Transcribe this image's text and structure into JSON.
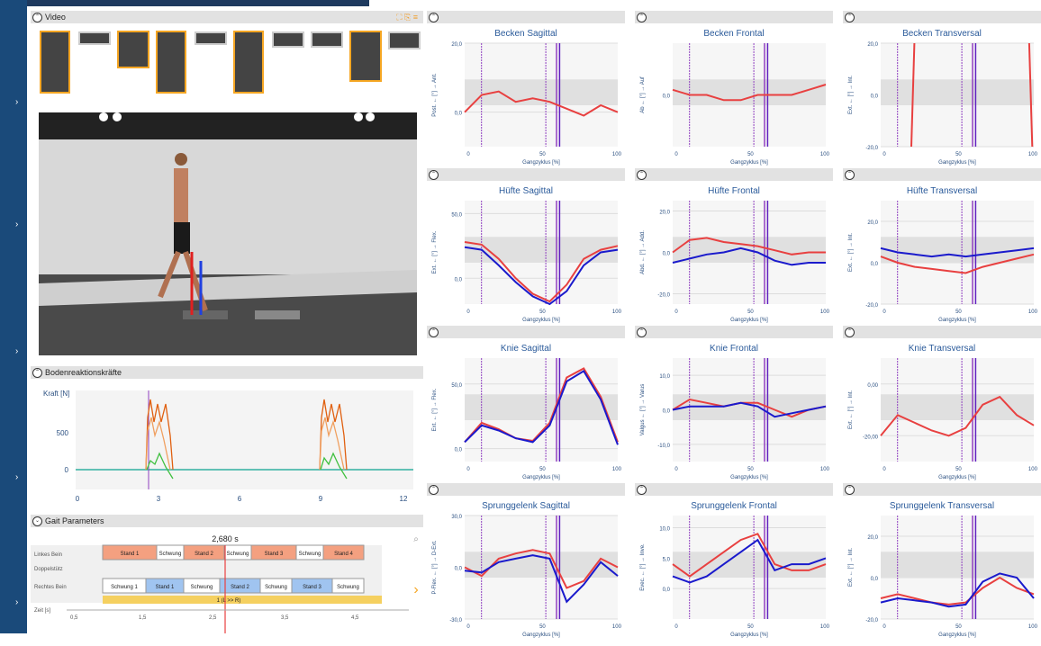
{
  "video": {
    "title": "Video"
  },
  "grf": {
    "title": "Bodenreaktionskräfte",
    "ylabel": "Kraft [N]",
    "yticks": [
      "500",
      "0"
    ],
    "xticks": [
      "0",
      "3",
      "6",
      "9",
      "12"
    ]
  },
  "gait": {
    "title": "Gait Parameters",
    "time": "2,680 s",
    "rows": [
      "Linkes Bein",
      "Doppelstütz",
      "Rechtes Bein"
    ],
    "left": [
      "Stand 1",
      "Schwung",
      "Stand 2",
      "Schwung",
      "Stand 3",
      "Schwung",
      "Stand 4"
    ],
    "right": [
      "Schwung 1",
      "Stand 1",
      "Schwung",
      "Stand 2",
      "Schwung",
      "Stand 3",
      "Schwung"
    ],
    "bar": "1 (L >> R)",
    "zlabel": "Zeit [s]",
    "zticks": [
      "0,5",
      "1,5",
      "2,5",
      "3,5",
      "4,5"
    ]
  },
  "xlabel": "Gangzyklus [%]",
  "xticks": [
    "0",
    "50",
    "100"
  ],
  "colors": {
    "left": "#e84040",
    "right": "#1a1acc",
    "event": "#7a2ad0"
  },
  "chart_data": [
    {
      "type": "line",
      "title": "Becken Sagittal",
      "ylabel": "Post. ←  [°]  → Ant.",
      "yticks": [
        "20,0",
        "0,0"
      ],
      "ylim": [
        -10,
        20
      ],
      "series": [
        {
          "values": [
            0,
            5,
            6,
            3,
            4,
            3,
            1,
            -1,
            2,
            0
          ]
        }
      ]
    },
    {
      "type": "line",
      "title": "Becken Frontal",
      "ylabel": "Ab ←  [°]  → Auf",
      "yticks": [
        "0,0"
      ],
      "ylim": [
        -10,
        10
      ],
      "series": [
        {
          "values": [
            1,
            0,
            0,
            -1,
            -1,
            0,
            0,
            0,
            1,
            2
          ]
        }
      ]
    },
    {
      "type": "line",
      "title": "Becken Transversal",
      "ylabel": "Ext. ←  [°]  → Int.",
      "yticks": [
        "20,0",
        "0,0",
        "-20,0"
      ],
      "ylim": [
        -20,
        20
      ],
      "series": []
    },
    {
      "type": "line",
      "title": "Hüfte Sagittal",
      "ylabel": "Ext. ←  [°]  → Flex.",
      "yticks": [
        "50,0",
        "0,0"
      ],
      "ylim": [
        -20,
        60
      ],
      "series": [
        {
          "values": [
            28,
            26,
            15,
            0,
            -12,
            -18,
            -5,
            15,
            22,
            25
          ]
        },
        {
          "values": [
            24,
            22,
            10,
            -3,
            -14,
            -20,
            -10,
            10,
            20,
            22
          ]
        }
      ]
    },
    {
      "type": "line",
      "title": "Hüfte Frontal",
      "ylabel": "Abd. ←  [°]  → Add.",
      "yticks": [
        "20,0",
        "0,0",
        "-20,0"
      ],
      "ylim": [
        -25,
        25
      ],
      "series": [
        {
          "values": [
            0,
            6,
            7,
            5,
            4,
            3,
            1,
            -1,
            0,
            0
          ]
        },
        {
          "values": [
            -5,
            -3,
            -1,
            0,
            2,
            0,
            -4,
            -6,
            -5,
            -5
          ]
        }
      ]
    },
    {
      "type": "line",
      "title": "Hüfte Transversal",
      "ylabel": "Ext. ←  [°]  → Int.",
      "yticks": [
        "20,0",
        "0,0",
        "-20,0"
      ],
      "ylim": [
        -20,
        30
      ],
      "series": [
        {
          "values": [
            3,
            0,
            -2,
            -3,
            -4,
            -5,
            -2,
            0,
            2,
            4
          ]
        },
        {
          "values": [
            7,
            5,
            4,
            3,
            4,
            3,
            4,
            5,
            6,
            7
          ]
        }
      ]
    },
    {
      "type": "line",
      "title": "Knie Sagittal",
      "ylabel": "Ext. ←  [°]  → Flex.",
      "yticks": [
        "50,0",
        "0,0"
      ],
      "ylim": [
        -10,
        70
      ],
      "series": [
        {
          "values": [
            5,
            20,
            15,
            8,
            6,
            20,
            55,
            62,
            40,
            5
          ]
        },
        {
          "values": [
            5,
            18,
            14,
            8,
            5,
            18,
            52,
            60,
            38,
            3
          ]
        }
      ]
    },
    {
      "type": "line",
      "title": "Knie Frontal",
      "ylabel": "Valgus ←  [°]  → Varus",
      "yticks": [
        "10,0",
        "0,0",
        "-10,0"
      ],
      "ylim": [
        -15,
        15
      ],
      "series": [
        {
          "values": [
            0,
            3,
            2,
            1,
            2,
            2,
            0,
            -2,
            0,
            1
          ]
        },
        {
          "values": [
            0,
            1,
            1,
            1,
            2,
            1,
            -2,
            -1,
            0,
            1
          ]
        }
      ]
    },
    {
      "type": "line",
      "title": "Knie Transversal",
      "ylabel": "Ext. ←  [°]  → Int.",
      "yticks": [
        "0,00",
        "-20,00"
      ],
      "ylim": [
        -30,
        10
      ],
      "series": [
        {
          "values": [
            -20,
            -12,
            -15,
            -18,
            -20,
            -17,
            -8,
            -5,
            -12,
            -16
          ]
        }
      ]
    },
    {
      "type": "line",
      "title": "Sprunggelenk Sagittal",
      "ylabel": "P-Flex. ←  [°]  → D-Ext.",
      "yticks": [
        "30,0",
        "0,0",
        "-30,0"
      ],
      "ylim": [
        -30,
        30
      ],
      "series": [
        {
          "values": [
            0,
            -5,
            5,
            8,
            10,
            8,
            -12,
            -8,
            5,
            0
          ]
        },
        {
          "values": [
            -2,
            -3,
            3,
            5,
            7,
            5,
            -20,
            -10,
            3,
            -5
          ]
        }
      ]
    },
    {
      "type": "line",
      "title": "Sprunggelenk Frontal",
      "ylabel": "Evec. ←  [°]  → Inve.",
      "yticks": [
        "10,0",
        "5,0",
        "0,0"
      ],
      "ylim": [
        -5,
        12
      ],
      "series": [
        {
          "values": [
            4,
            2,
            4,
            6,
            8,
            9,
            4,
            3,
            3,
            4
          ]
        },
        {
          "values": [
            2,
            1,
            2,
            4,
            6,
            8,
            3,
            4,
            4,
            5
          ]
        }
      ]
    },
    {
      "type": "line",
      "title": "Sprunggelenk Transversal",
      "ylabel": "Ext. ←  [°]  → Int.",
      "yticks": [
        "20,0",
        "0,0",
        "-20,0"
      ],
      "ylim": [
        -20,
        30
      ],
      "series": [
        {
          "values": [
            -10,
            -8,
            -10,
            -12,
            -13,
            -12,
            -5,
            0,
            -5,
            -8
          ]
        },
        {
          "values": [
            -12,
            -10,
            -11,
            -12,
            -14,
            -13,
            -2,
            2,
            0,
            -10
          ]
        }
      ]
    }
  ]
}
